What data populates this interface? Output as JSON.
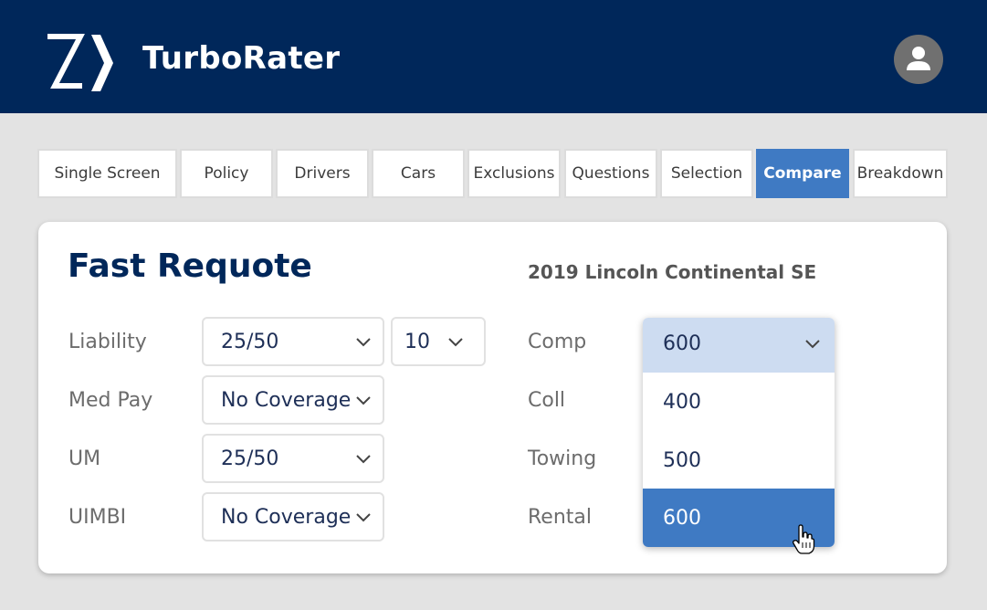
{
  "app": {
    "title": "TurboRater",
    "logo_text": "Z"
  },
  "tabs": [
    {
      "label": "Single Screen",
      "active": false
    },
    {
      "label": "Policy",
      "active": false
    },
    {
      "label": "Drivers",
      "active": false
    },
    {
      "label": "Cars",
      "active": false
    },
    {
      "label": "Exclusions",
      "active": false
    },
    {
      "label": "Questions",
      "active": false
    },
    {
      "label": "Selection",
      "active": false
    },
    {
      "label": "Compare",
      "active": true
    },
    {
      "label": "Breakdown",
      "active": false
    }
  ],
  "card": {
    "title": "Fast Requote",
    "vehicle": "2019 Lincoln Continental SE",
    "left_fields": [
      {
        "label": "Liability",
        "value": "25/50",
        "extra_value": "10"
      },
      {
        "label": "Med Pay",
        "value": "No Coverage"
      },
      {
        "label": "UM",
        "value": "25/50"
      },
      {
        "label": "UIMBI",
        "value": "No Coverage"
      }
    ],
    "right_fields": [
      {
        "label": "Comp"
      },
      {
        "label": "Coll"
      },
      {
        "label": "Towing"
      },
      {
        "label": "Rental"
      }
    ],
    "comp_dropdown": {
      "selected": "600",
      "options": [
        "400",
        "500",
        "600"
      ],
      "highlighted_index": 2
    }
  },
  "colors": {
    "header_bg": "#00275a",
    "accent": "#3f7ac3",
    "dropdown_head": "#cddcf1",
    "page_bg": "#e3e3e3"
  },
  "icons": {
    "logo": "turborater-logo",
    "avatar": "user-icon",
    "chevron": "chevron-down-icon",
    "cursor": "hand-pointer-icon"
  }
}
